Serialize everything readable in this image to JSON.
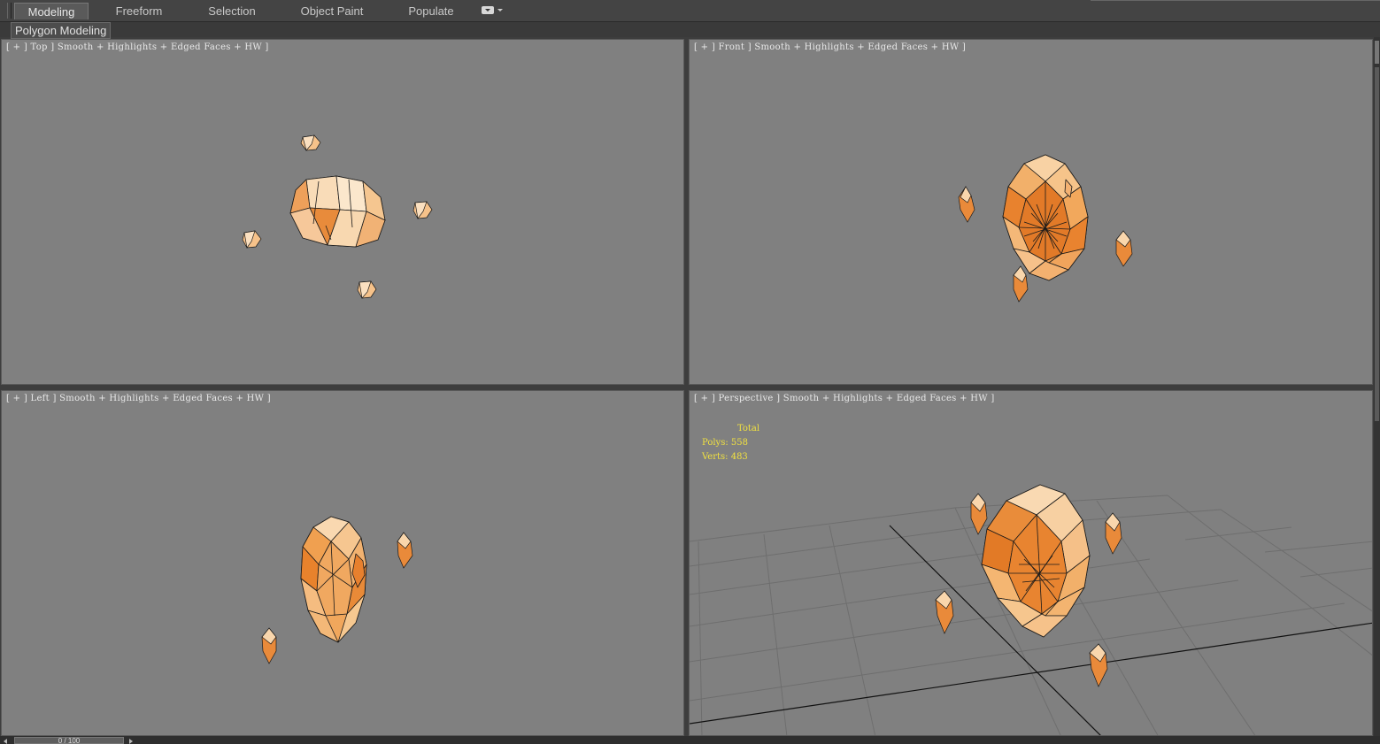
{
  "menu": {
    "tabs": [
      {
        "label": "Modeling",
        "active": true
      },
      {
        "label": "Freeform",
        "active": false
      },
      {
        "label": "Selection",
        "active": false
      },
      {
        "label": "Object Paint",
        "active": false
      },
      {
        "label": "Populate",
        "active": false
      }
    ],
    "options_icon": "dropdown-icon"
  },
  "ribbon": {
    "panel_label": "Polygon Modeling"
  },
  "viewports": [
    {
      "name": "top",
      "label": "[ + ] Top ] Smooth + Highlights + Edged Faces + HW ]"
    },
    {
      "name": "front",
      "label": "[ + ] Front ] Smooth + Highlights + Edged Faces + HW ]"
    },
    {
      "name": "left",
      "label": "[ + ] Left ] Smooth + Highlights + Edged Faces + HW ]"
    },
    {
      "name": "perspective",
      "label": "[ + ] Perspective ] Smooth + Highlights + Edged Faces + HW ]"
    }
  ],
  "stats": {
    "title": "Total",
    "polys": "Polys: 558",
    "verts": "Verts: 483"
  },
  "timeline": {
    "frame": "0 / 100"
  },
  "colors": {
    "viewport_bg": "#808080",
    "mesh_light": "#f7c891",
    "mesh_dark": "#e8781a",
    "stats_text": "#f0e040",
    "grid_line": "#6e6e6e"
  }
}
